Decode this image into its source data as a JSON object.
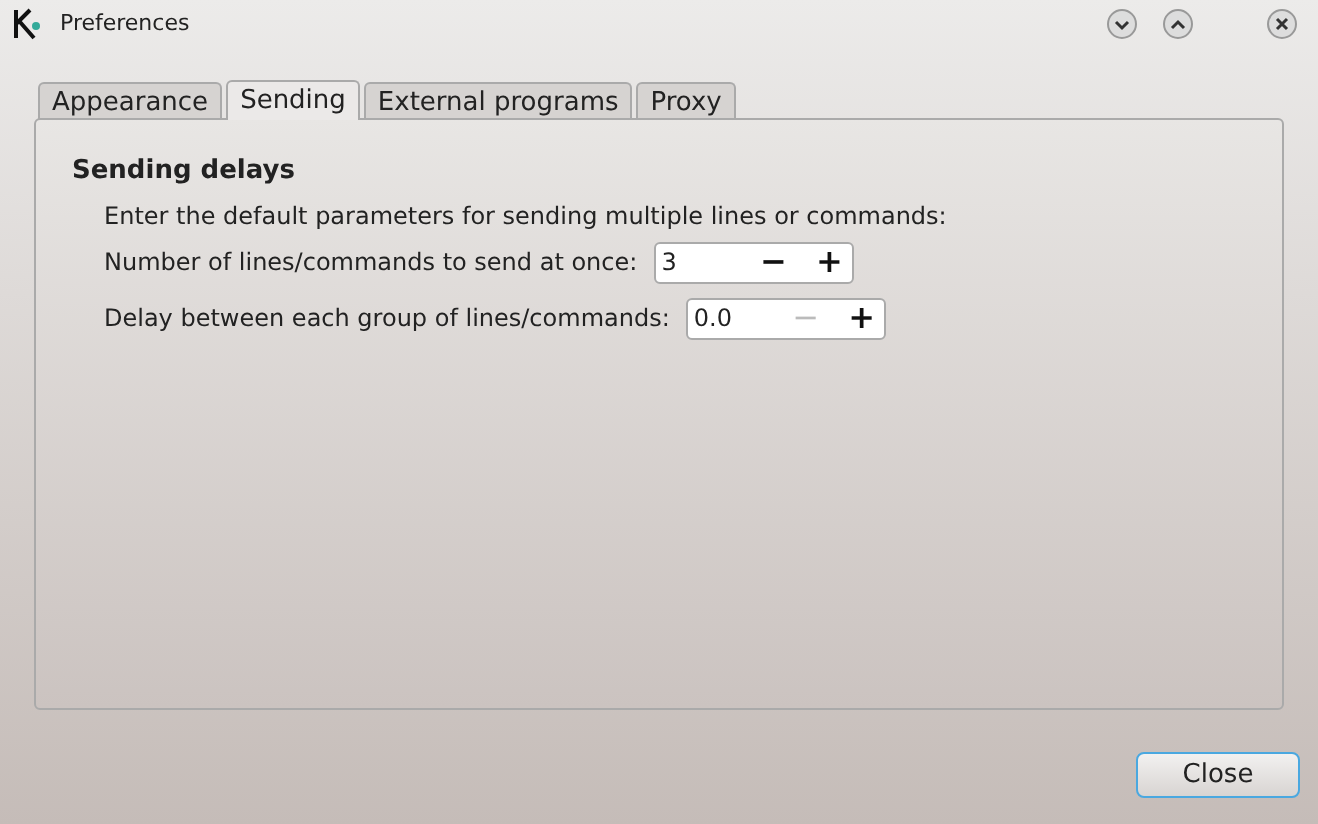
{
  "window": {
    "title": "Preferences"
  },
  "tabs": [
    {
      "label": "Appearance",
      "selected": false
    },
    {
      "label": "Sending",
      "selected": true
    },
    {
      "label": "External programs",
      "selected": false
    },
    {
      "label": "Proxy",
      "selected": false
    }
  ],
  "section": {
    "title": "Sending delays",
    "description": "Enter the default parameters for sending multiple lines or commands:"
  },
  "fields": [
    {
      "label": "Number of lines/commands to send at once:",
      "value": "3",
      "minus": "−",
      "plus": "+",
      "minus_disabled": false
    },
    {
      "label": "Delay between each group of lines/commands:",
      "value": "0.0",
      "minus": "−",
      "plus": "+",
      "minus_disabled": true
    }
  ],
  "buttons": [
    {
      "label": "Close"
    }
  ]
}
